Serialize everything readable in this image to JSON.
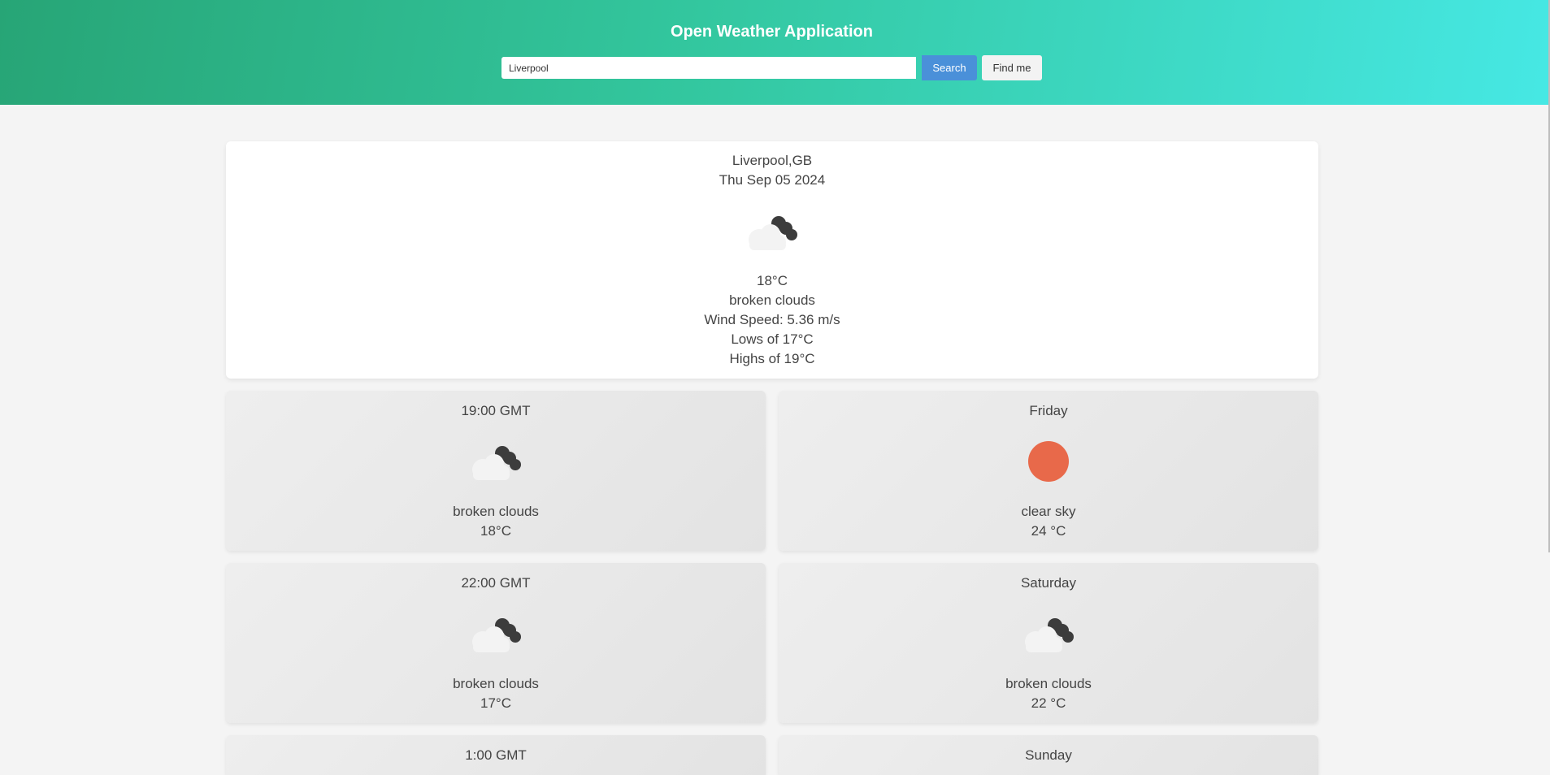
{
  "header": {
    "title": "Open Weather Application",
    "search_value": "Liverpool",
    "search_button": "Search",
    "findme_button": "Find me"
  },
  "current": {
    "location": "Liverpool,GB",
    "date": "Thu Sep 05 2024",
    "icon": "broken-clouds-icon",
    "temp": "18°C",
    "description": "broken clouds",
    "wind": "Wind Speed: 5.36 m/s",
    "low": "Lows of 17°C",
    "high": "Highs of 19°C"
  },
  "hourly": [
    {
      "time": "19:00 GMT",
      "icon": "broken-clouds-icon",
      "description": "broken clouds",
      "temp": "18°C"
    },
    {
      "time": "22:00 GMT",
      "icon": "broken-clouds-icon",
      "description": "broken clouds",
      "temp": "17°C"
    },
    {
      "time": "1:00 GMT"
    }
  ],
  "daily": [
    {
      "day": "Friday",
      "icon": "clear-sky-icon",
      "description": "clear sky",
      "temp": "24 °C"
    },
    {
      "day": "Saturday",
      "icon": "broken-clouds-icon",
      "description": "broken clouds",
      "temp": "22 °C"
    },
    {
      "day": "Sunday"
    }
  ],
  "colors": {
    "header_start": "#27a576",
    "header_end": "#46e8e4",
    "search_button": "#4a90d9",
    "sun": "#e8694a"
  }
}
